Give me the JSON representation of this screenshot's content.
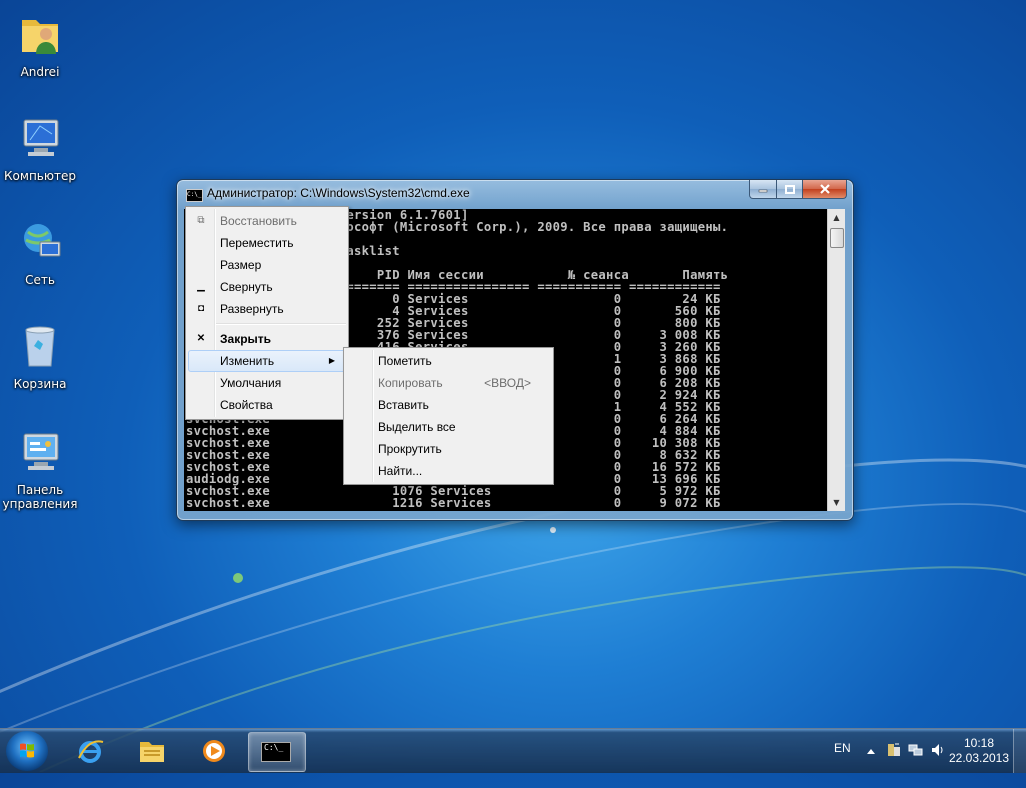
{
  "desktop": {
    "icons": [
      {
        "label": "Andrei",
        "icon": "user-folder-icon"
      },
      {
        "label": "Компьютер",
        "icon": "computer-icon"
      },
      {
        "label": "Сеть",
        "icon": "network-icon"
      },
      {
        "label": "Корзина",
        "icon": "recycle-bin-icon"
      },
      {
        "label": "Панель управления",
        "icon": "control-panel-icon"
      }
    ]
  },
  "window": {
    "title": "Администратор: C:\\Windows\\System32\\cmd.exe",
    "title_icon": "C:\\_",
    "console_lines": [
      "                     ersion 6.1.7601]",
      "                     ософт (Microsoft Corp.), 2009. Все права защищены.",
      "",
      "                     asklist",
      "",
      "                         PID Имя сессии           № сеанса       Память",
      "                     ======= ================ =========== ============",
      "                           0 Services                   0        24 КБ",
      "                           4 Services                   0       560 КБ",
      "                         252 Services                   0       800 КБ",
      "                         376 Services                   0     3 008 КБ",
      "                         416 Services                   0     3 260 КБ",
      "                                                        1     3 868 КБ",
      "                                                        0     6 900 КБ",
      "                                                        0     6 208 КБ",
      "                                                        0     2 924 КБ",
      "                                                        1     4 552 КБ",
      "svchost.exe                                             0     6 264 КБ",
      "svchost.exe                                             0     4 884 КБ",
      "svchost.exe                                             0    10 308 КБ",
      "svchost.exe                                             0     8 632 КБ",
      "svchost.exe                                             0    16 572 КБ",
      "audiodg.exe                                             0    13 696 КБ",
      "svchost.exe                1076 Services                0     5 972 КБ",
      "svchost.exe                1216 Services                0     9 072 КБ"
    ]
  },
  "system_menu": [
    {
      "label": "Восстановить",
      "disabled": true,
      "icon": "restore-icon"
    },
    {
      "label": "Переместить"
    },
    {
      "label": "Размер"
    },
    {
      "label": "Свернуть",
      "icon": "minimize-icon"
    },
    {
      "label": "Развернуть",
      "icon": "maximize-icon"
    },
    {
      "label": "Закрыть",
      "bold": true,
      "icon": "close-icon"
    },
    {
      "label": "Изменить",
      "submenu": true,
      "highlighted": true
    },
    {
      "label": "Умолчания"
    },
    {
      "label": "Свойства"
    }
  ],
  "edit_submenu": [
    {
      "label": "Пометить"
    },
    {
      "label": "Копировать",
      "disabled": true,
      "accel": "<ВВОД>"
    },
    {
      "label": "Вставить"
    },
    {
      "label": "Выделить все"
    },
    {
      "label": "Прокрутить"
    },
    {
      "label": "Найти..."
    }
  ],
  "taskbar": {
    "pinned": [
      "ie-icon",
      "explorer-icon",
      "media-player-icon",
      "cmd-icon"
    ],
    "active_label": "C:\\_",
    "language": "EN",
    "time": "10:18",
    "date": "22.03.2013"
  },
  "colors": {
    "accent": "#1f7fd4",
    "console_bg": "#000000",
    "console_fg": "#c0c0c0"
  }
}
